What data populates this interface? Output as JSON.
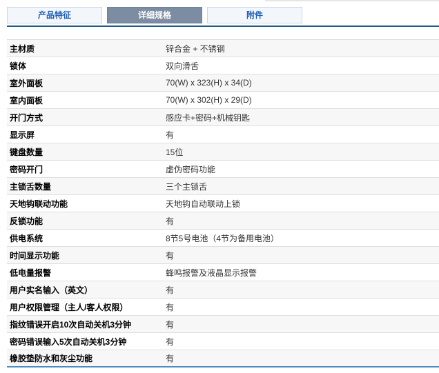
{
  "tabs": [
    {
      "label": "产品特征",
      "active": false
    },
    {
      "label": "详细规格",
      "active": true
    },
    {
      "label": "附件",
      "active": false
    }
  ],
  "specs": [
    {
      "label": "主材质",
      "value": "锌合金 + 不锈钢"
    },
    {
      "label": "锁体",
      "value": "双向滑舌"
    },
    {
      "label": "室外面板",
      "value": "70(W) x 323(H) x 34(D)"
    },
    {
      "label": "室内面板",
      "value": "70(W) x 302(H) x 29(D)"
    },
    {
      "label": "开门方式",
      "value": "感应卡+密码+机械钥匙"
    },
    {
      "label": "显示屏",
      "value": "有"
    },
    {
      "label": "键盘数量",
      "value": "15位"
    },
    {
      "label": "密码开门",
      "value": "虚伪密码功能"
    },
    {
      "label": "主锁舌数量",
      "value": "三个主锁舌"
    },
    {
      "label": "天地钩联动功能",
      "value": "天地钩自动联动上锁"
    },
    {
      "label": "反锁功能",
      "value": "有"
    },
    {
      "label": "供电系统",
      "value": "8节5号电池（4节为备用电池）"
    },
    {
      "label": "时间显示功能",
      "value": "有"
    },
    {
      "label": "低电量报警",
      "value": "蜂鸣报警及液晶显示报警"
    },
    {
      "label": "用户实名输入（英文）",
      "value": "有"
    },
    {
      "label": "用户权限管理（主人/客人权限）",
      "value": "有"
    },
    {
      "label": "指纹错误开启10次自动关机3分钟",
      "value": "有"
    },
    {
      "label": "密码错误输入5次自动关机3分钟",
      "value": "有"
    },
    {
      "label": "橡胶垫防水和灰尘功能",
      "value": "有"
    }
  ]
}
